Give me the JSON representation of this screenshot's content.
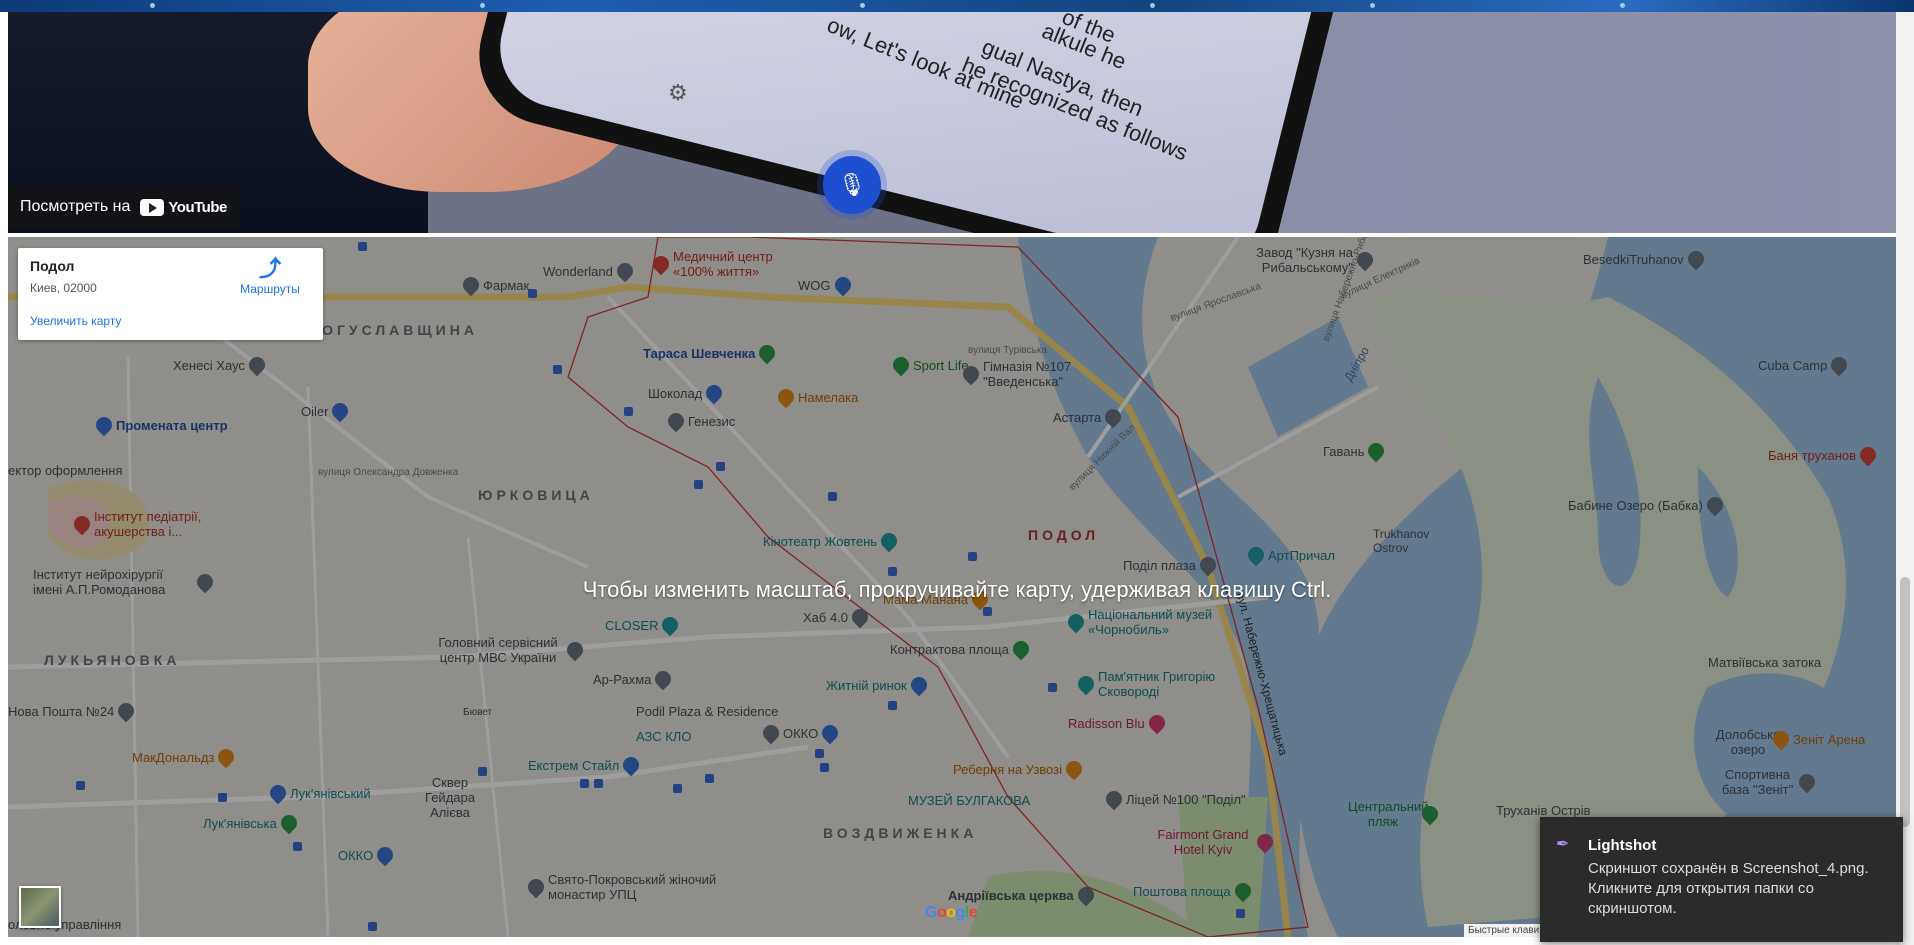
{
  "video": {
    "watch_on_label": "Посмотреть на",
    "youtube_label": "YouTube",
    "caption_lines": [
      "of the",
      "alkule he",
      "gual Nastya, then",
      "he recognized as follows",
      "ow, Let's look at mine"
    ]
  },
  "map": {
    "place_card": {
      "title": "Подол",
      "address": "Киев, 02000",
      "enlarge_link": "Увеличить карту",
      "directions_label": "Маршруты"
    },
    "zoom_hint": "Чтобы изменить масштаб, прокручивайте карту, удерживая клавишу Ctrl.",
    "google_logo": [
      "G",
      "o",
      "o",
      "g",
      "l",
      "e"
    ],
    "shortcuts_label": "Быстрые клави",
    "districts": [
      "БОГУСЛАВЩИНА",
      "ЮРКОВИЦА",
      "ПОДОЛ",
      "ЛУКЬЯНОВКА",
      "ВОЗДВИЖЕНКА"
    ],
    "pois": [
      {
        "label": "Фармак",
        "color": "gray"
      },
      {
        "label": "Wonderland",
        "color": "gray"
      },
      {
        "label": "Медичний центр «100% життя»",
        "color": "red"
      },
      {
        "label": "WOG",
        "color": "blue"
      },
      {
        "label": "Завод \"Кузня на Рибальському\"",
        "color": "gray"
      },
      {
        "label": "BesedkiTruhanov",
        "color": "gray"
      },
      {
        "label": "Хенесі Хаус",
        "color": "gray"
      },
      {
        "label": "Тараса Шевченка",
        "color": "blue"
      },
      {
        "label": "Sport Life",
        "color": "green"
      },
      {
        "label": "Гімназія №107 \"Введенська\"",
        "color": "gray"
      },
      {
        "label": "Cuba Camp",
        "color": "gray"
      },
      {
        "label": "Oiler",
        "color": "blue"
      },
      {
        "label": "Шоколад",
        "color": "blue"
      },
      {
        "label": "Намелака",
        "color": "orange"
      },
      {
        "label": "Промената центр",
        "color": "blue"
      },
      {
        "label": "Генезис",
        "color": "gray"
      },
      {
        "label": "Астарта",
        "color": "gray"
      },
      {
        "label": "Гавань",
        "color": "green"
      },
      {
        "label": "Баня труханов",
        "color": "red"
      },
      {
        "label": "ектор оформлення",
        "color": "gray"
      },
      {
        "label": "Інститут педіатрії, акушерства і...",
        "color": "red"
      },
      {
        "label": "Бабине Озеро (Бабка)",
        "color": "gray"
      },
      {
        "label": "Trukhanov Ostrov",
        "color": "gray"
      },
      {
        "label": "Кінотеатр Жовтень",
        "color": "teal"
      },
      {
        "label": "АртПричал",
        "color": "teal"
      },
      {
        "label": "Поділ плаза",
        "color": "gray"
      },
      {
        "label": "Інститут нейрохірургії імені А.П.Ромоданова",
        "color": "gray"
      },
      {
        "label": "Мама Манана",
        "color": "orange"
      },
      {
        "label": "Хаб 4.0",
        "color": "gray"
      },
      {
        "label": "Національний музей «Чорнобиль»",
        "color": "teal"
      },
      {
        "label": "CLOSER",
        "color": "teal"
      },
      {
        "label": "Контрактова площа",
        "color": "gray"
      },
      {
        "label": "Головний сервісний центр МВС України",
        "color": "gray"
      },
      {
        "label": "Ар-Рахма",
        "color": "gray"
      },
      {
        "label": "Пам'ятник Григорію Сковороді",
        "color": "teal"
      },
      {
        "label": "Житній ринок",
        "color": "blue"
      },
      {
        "label": "Матвіївська затока",
        "color": "gray"
      },
      {
        "label": "Нова Пошта №24",
        "color": "gray"
      },
      {
        "label": "Podil Plaza & Residence",
        "color": "gray"
      },
      {
        "label": "Radisson Blu",
        "color": "pink"
      },
      {
        "label": "АЗС КЛО",
        "color": "blue"
      },
      {
        "label": "ОККО",
        "color": "blue"
      },
      {
        "label": "Долобське озеро",
        "color": "gray"
      },
      {
        "label": "Зеніт Арена",
        "color": "orange"
      },
      {
        "label": "МакДональдз",
        "color": "orange"
      },
      {
        "label": "Екстрем Стайл",
        "color": "blue"
      },
      {
        "label": "Реберня на Узвозі",
        "color": "orange"
      },
      {
        "label": "Спортивна база \"Зеніт\"",
        "color": "gray"
      },
      {
        "label": "Лук'янівський",
        "color": "blue"
      },
      {
        "label": "Сквер Гейдара Алієва",
        "color": "gray"
      },
      {
        "label": "МУЗЕЙ БУЛГАКОВА",
        "color": "teal"
      },
      {
        "label": "Ліцей №100 \"Поділ\"",
        "color": "gray"
      },
      {
        "label": "Центральний пляж",
        "color": "green"
      },
      {
        "label": "Труханів Острів",
        "color": "gray"
      },
      {
        "label": "Лук'янівська",
        "color": "gray"
      },
      {
        "label": "ОККО",
        "color": "blue"
      },
      {
        "label": "Fairmont Grand Hotel Kyiv",
        "color": "pink"
      },
      {
        "label": "Свято-Покровський жіночий монастир УПЦ",
        "color": "gray"
      },
      {
        "label": "Андріївська церква",
        "color": "gray"
      },
      {
        "label": "Поштова площа",
        "color": "gray"
      },
      {
        "label": "оловне управління",
        "color": "gray"
      },
      {
        "label": "Бювет",
        "color": "gray"
      }
    ],
    "streets": [
      "вулиця Турівська",
      "вулиця Нижній Вал",
      "вул. Набережно-Хрещатицька",
      "Дніпро",
      "вулиця Ярославська",
      "вулиця Електриків",
      "вулиця Набережно-Рибальська",
      "вулиця Олександра Довженка"
    ]
  },
  "toast": {
    "app_name": "Lightshot",
    "message": "Скриншот сохранён в Screenshot_4.png. Кликните для открытия папки со скриншотом."
  }
}
